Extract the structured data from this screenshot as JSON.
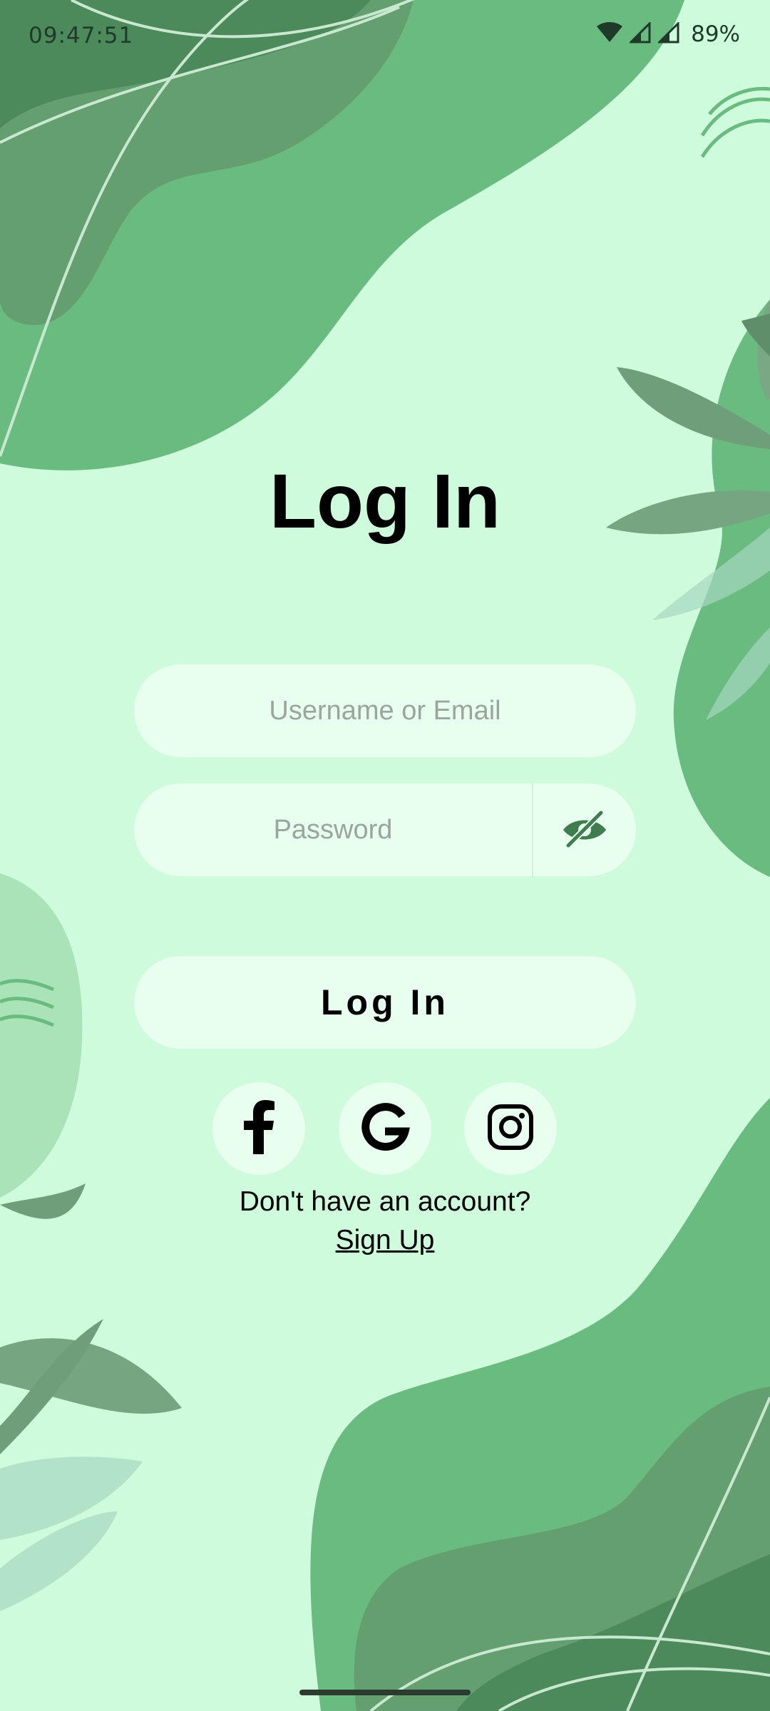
{
  "status_bar": {
    "time": "09:47:51",
    "battery": "89%",
    "icons": [
      "wifi-icon",
      "cell-signal-icon",
      "cell-signal-icon",
      "battery"
    ]
  },
  "login": {
    "title": "Log In",
    "username_placeholder": "Username or Email",
    "password_placeholder": "Password",
    "password_visibility_icon": "eye-off-icon",
    "submit_label": "Log In"
  },
  "social": {
    "buttons": [
      "facebook-icon",
      "google-icon",
      "instagram-icon"
    ]
  },
  "signup": {
    "prompt": "Don't have an account?",
    "link_label": "Sign Up"
  },
  "colors": {
    "background": "#cdfbdb",
    "field_background": "#e8feee",
    "accent_green": "#6abb7f",
    "dark_green": "#3f7d4f"
  }
}
